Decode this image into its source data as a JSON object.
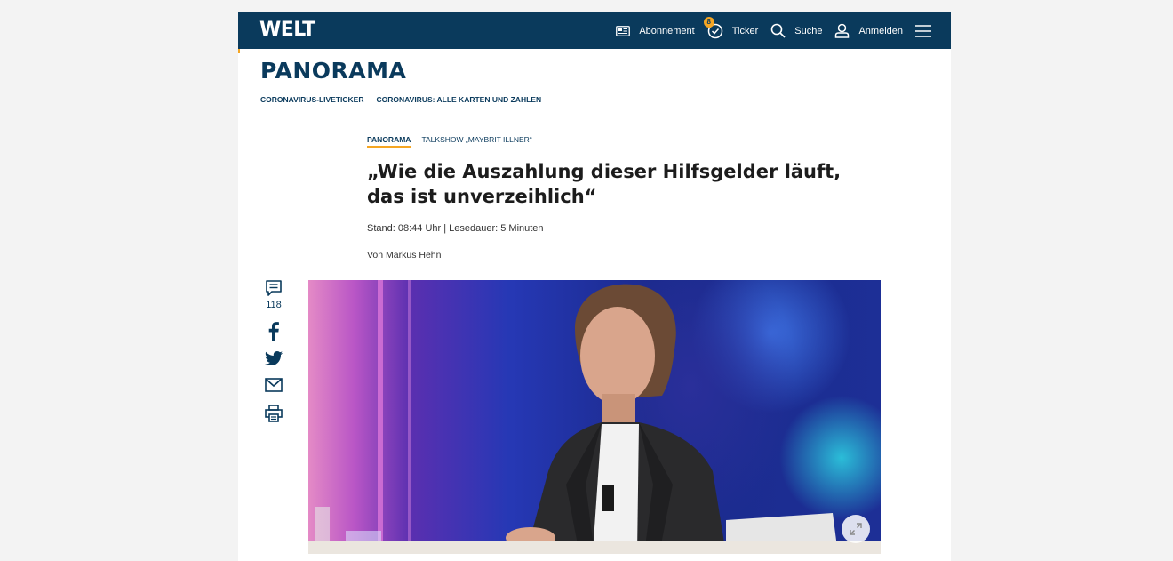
{
  "header": {
    "logo": "WELT",
    "nav": {
      "subscription": "Abonnement",
      "ticker": "Ticker",
      "ticker_badge": "8",
      "search": "Suche",
      "login": "Anmelden"
    }
  },
  "section": {
    "title": "PANORAMA",
    "links": [
      "CORONAVIRUS-LIVETICKER",
      "CORONAVIRUS: ALLE KARTEN UND ZAHLEN"
    ]
  },
  "article": {
    "breadcrumb_section": "PANORAMA",
    "breadcrumb_topic": "TALKSHOW „MAYBRIT ILLNER“",
    "headline": "„Wie die Auszahlung dieser Hilfsgelder läuft, das ist unverzeihlich“",
    "meta": "Stand: 08:44 Uhr | Lesedauer: 5 Minuten",
    "author": "Von Markus Hehn"
  },
  "share": {
    "comment_count": "118",
    "icons": [
      "comment-icon",
      "facebook-icon",
      "twitter-icon",
      "mail-icon",
      "print-icon"
    ]
  },
  "hero": {
    "icon": "expand-icon"
  },
  "colors": {
    "brand_navy": "#0a3a5c",
    "accent_orange": "#f5a623"
  }
}
